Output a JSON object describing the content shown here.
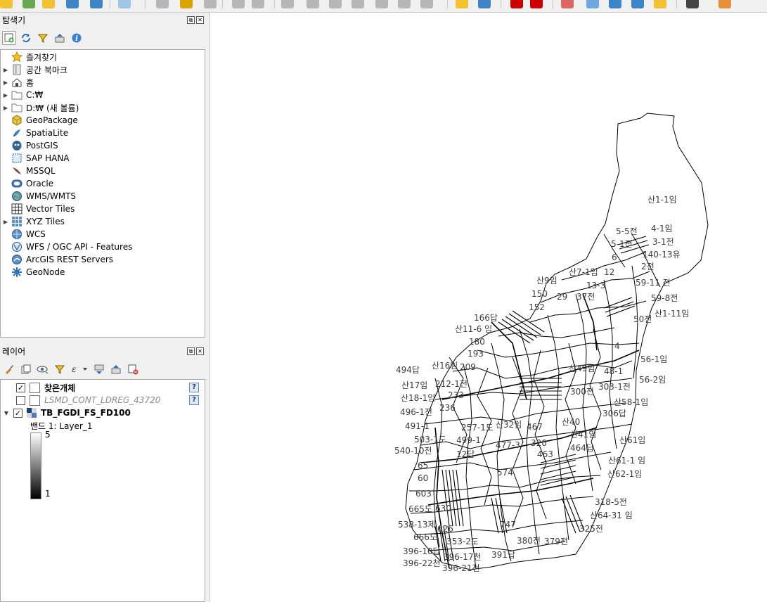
{
  "toolbar": {
    "icons": [
      "new-layer-icon",
      "vertex-tool-icon",
      "digitize-icon",
      "add-feature-icon",
      "grid-icon",
      "field-calc-icon",
      "pen-icon",
      "pencil-icon",
      "save-edits-icon",
      "move-feature-icon",
      "scissors-icon",
      "node-tool-icon",
      "delete-icon",
      "cut-icon",
      "copy-icon",
      "paste-icon",
      "undo-icon",
      "redo-icon",
      "label-icon",
      "chart-icon",
      "pin-icon",
      "text-annotation-icon",
      "pin-red-icon",
      "eye-icon",
      "export-icon",
      "refresh-icon",
      "sticky-note-icon",
      "binoculars-icon",
      "plugin-icon"
    ]
  },
  "browser_panel": {
    "title": "탐색기",
    "items": [
      {
        "label": "즐겨찾기",
        "icon": "star-icon",
        "expandable": false
      },
      {
        "label": "공간 북마크",
        "icon": "bookmark-icon",
        "expandable": true
      },
      {
        "label": "홈",
        "icon": "home-icon",
        "expandable": true
      },
      {
        "label": "C:₩",
        "icon": "folder-icon",
        "expandable": true
      },
      {
        "label": "D:₩ (새 볼륨)",
        "icon": "folder-icon",
        "expandable": true
      },
      {
        "label": "GeoPackage",
        "icon": "geopackage-icon",
        "expandable": false
      },
      {
        "label": "SpatiaLite",
        "icon": "spatialite-icon",
        "expandable": false
      },
      {
        "label": "PostGIS",
        "icon": "postgis-icon",
        "expandable": false
      },
      {
        "label": "SAP HANA",
        "icon": "sap-hana-icon",
        "expandable": false
      },
      {
        "label": "MSSQL",
        "icon": "mssql-icon",
        "expandable": false
      },
      {
        "label": "Oracle",
        "icon": "oracle-icon",
        "expandable": false
      },
      {
        "label": "WMS/WMTS",
        "icon": "wms-globe-icon",
        "expandable": false
      },
      {
        "label": "Vector Tiles",
        "icon": "vector-tiles-icon",
        "expandable": false
      },
      {
        "label": "XYZ Tiles",
        "icon": "xyz-tiles-icon",
        "expandable": true
      },
      {
        "label": "WCS",
        "icon": "wcs-globe-icon",
        "expandable": false
      },
      {
        "label": "WFS / OGC API - Features",
        "icon": "wfs-icon",
        "expandable": false
      },
      {
        "label": "ArcGIS REST Servers",
        "icon": "arcgis-icon",
        "expandable": false
      },
      {
        "label": "GeoNode",
        "icon": "geonode-icon",
        "expandable": false
      }
    ]
  },
  "layers_panel": {
    "title": "레이어",
    "layers": [
      {
        "name": "찾은개체",
        "checked": true,
        "bold": true,
        "italic": false,
        "badge": "?"
      },
      {
        "name": "LSMD_CONT_LDREG_43720",
        "checked": false,
        "bold": false,
        "italic": true,
        "badge": "?"
      },
      {
        "name": "TB_FGDI_FS_FD100",
        "checked": true,
        "bold": true,
        "italic": false,
        "badge": ""
      }
    ],
    "band_label": "밴드 1: Layer_1",
    "ramp_max": "5",
    "ramp_min": "1"
  },
  "map": {
    "labels": [
      {
        "t": "산1-1임"
      },
      {
        "t": "5-5전"
      },
      {
        "t": "4-1임"
      },
      {
        "t": "5-1전"
      },
      {
        "t": "3-1전"
      },
      {
        "t": "6"
      },
      {
        "t": "140-13유"
      },
      {
        "t": "2전"
      },
      {
        "t": "산7-1임"
      },
      {
        "t": "12"
      },
      {
        "t": "산9임"
      },
      {
        "t": "13-3"
      },
      {
        "t": "59-11 전"
      },
      {
        "t": "150"
      },
      {
        "t": "29"
      },
      {
        "t": "37전"
      },
      {
        "t": "59-8전"
      },
      {
        "t": "152"
      },
      {
        "t": "산1-11임"
      },
      {
        "t": "166답"
      },
      {
        "t": "50전"
      },
      {
        "t": "산11-6 임"
      },
      {
        "t": "180"
      },
      {
        "t": "193"
      },
      {
        "t": "4"
      },
      {
        "t": "56-1임"
      },
      {
        "t": "494답"
      },
      {
        "t": "산16임"
      },
      {
        "t": "209"
      },
      {
        "t": "산49임"
      },
      {
        "t": "48-1"
      },
      {
        "t": "산17임"
      },
      {
        "t": "212-1전"
      },
      {
        "t": "56-2임"
      },
      {
        "t": "300전"
      },
      {
        "t": "303-1전"
      },
      {
        "t": "233"
      },
      {
        "t": "산18-1임"
      },
      {
        "t": "산58-1임"
      },
      {
        "t": "236"
      },
      {
        "t": "496-1전"
      },
      {
        "t": "306답"
      },
      {
        "t": "산32임"
      },
      {
        "t": "467"
      },
      {
        "t": "산40"
      },
      {
        "t": "491-1"
      },
      {
        "t": "257-1도"
      },
      {
        "t": "503-1도"
      },
      {
        "t": "499-1"
      },
      {
        "t": "산41임"
      },
      {
        "t": "산61임"
      },
      {
        "t": "477-3"
      },
      {
        "t": "320"
      },
      {
        "t": "540-10전"
      },
      {
        "t": "464답"
      },
      {
        "t": "12답"
      },
      {
        "t": "463"
      },
      {
        "t": "산61-1 임"
      },
      {
        "t": "65"
      },
      {
        "t": "산62-1임"
      },
      {
        "t": "60"
      },
      {
        "t": "574"
      },
      {
        "t": "603"
      },
      {
        "t": "318-5전"
      },
      {
        "t": "665도"
      },
      {
        "t": "630"
      },
      {
        "t": "산64-31 임"
      },
      {
        "t": "538-13제"
      },
      {
        "t": "626"
      },
      {
        "t": "747"
      },
      {
        "t": "325전"
      },
      {
        "t": "666도"
      },
      {
        "t": "353-2도"
      },
      {
        "t": "380전"
      },
      {
        "t": "379전"
      },
      {
        "t": "396-10답"
      },
      {
        "t": "396-17천"
      },
      {
        "t": "391답"
      },
      {
        "t": "396-22천"
      },
      {
        "t": "396-21천"
      }
    ]
  }
}
